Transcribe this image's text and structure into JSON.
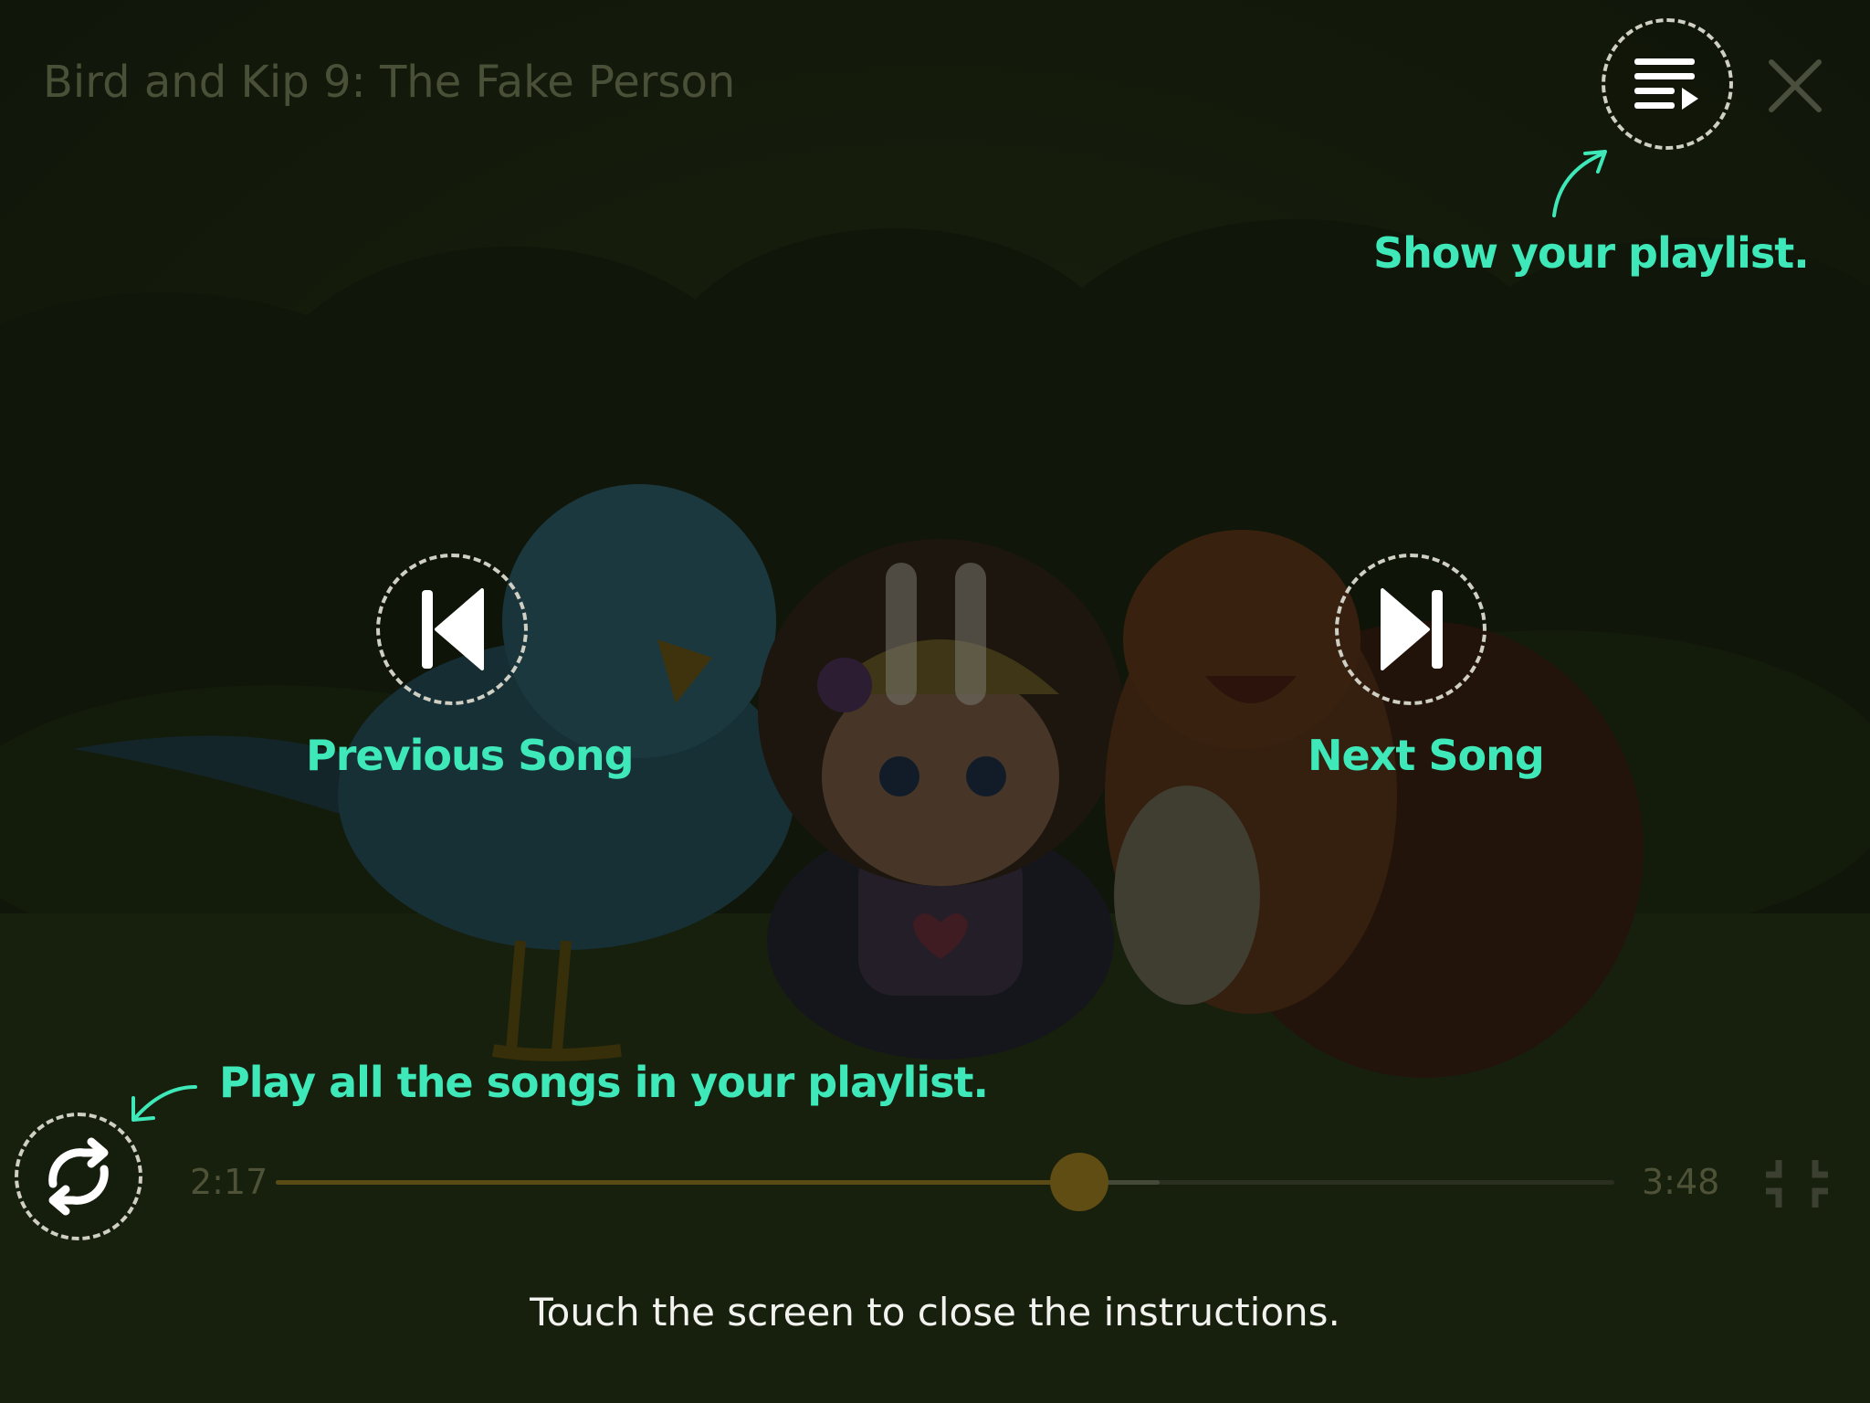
{
  "video": {
    "title": "Bird and Kip 9: The Fake Person",
    "current_time": "2:17",
    "duration": "3:48",
    "progress": 0.6,
    "buffered": 0.66,
    "state": "playing"
  },
  "hints": {
    "playlist": "Show your playlist.",
    "previous": "Previous Song",
    "next": "Next Song",
    "play_all": "Play all the songs in your playlist."
  },
  "footer": {
    "instruction": "Touch the screen to close the instructions."
  },
  "colors": {
    "hint_accent": "#3ee8b8",
    "progress_fill": "#5a4a16",
    "overlay_bg": "#1c2412"
  },
  "icons": {
    "playlist": "playlist-icon",
    "close": "close-icon",
    "previous": "skip-previous-icon",
    "next": "skip-next-icon",
    "pause": "pause-icon",
    "repeat": "repeat-icon",
    "exit_fullscreen": "exit-fullscreen-icon"
  }
}
